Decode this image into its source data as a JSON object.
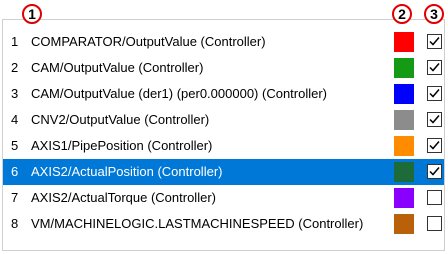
{
  "callouts": [
    "1",
    "2",
    "3"
  ],
  "rows": [
    {
      "num": "1",
      "label": "COMPARATOR/OutputValue (Controller)",
      "color": "#ff0000",
      "checked": true,
      "selected": false
    },
    {
      "num": "2",
      "label": "CAM/OutputValue (Controller)",
      "color": "#159a15",
      "checked": true,
      "selected": false
    },
    {
      "num": "3",
      "label": "CAM/OutputValue (der1) (per0.000000) (Controller)",
      "color": "#0000ff",
      "checked": true,
      "selected": false
    },
    {
      "num": "4",
      "label": "CNV2/OutputValue (Controller)",
      "color": "#8c8c8c",
      "checked": true,
      "selected": false
    },
    {
      "num": "5",
      "label": "AXIS1/PipePosition (Controller)",
      "color": "#ff8c00",
      "checked": true,
      "selected": false
    },
    {
      "num": "6",
      "label": "AXIS2/ActualPosition (Controller)",
      "color": "#1e6b3a",
      "checked": true,
      "selected": true
    },
    {
      "num": "7",
      "label": "AXIS2/ActualTorque (Controller)",
      "color": "#8a00ff",
      "checked": false,
      "selected": false
    },
    {
      "num": "8",
      "label": "VM/MACHINELOGIC.LASTMACHINESPEED (Controller)",
      "color": "#b8600a",
      "checked": false,
      "selected": false
    }
  ]
}
